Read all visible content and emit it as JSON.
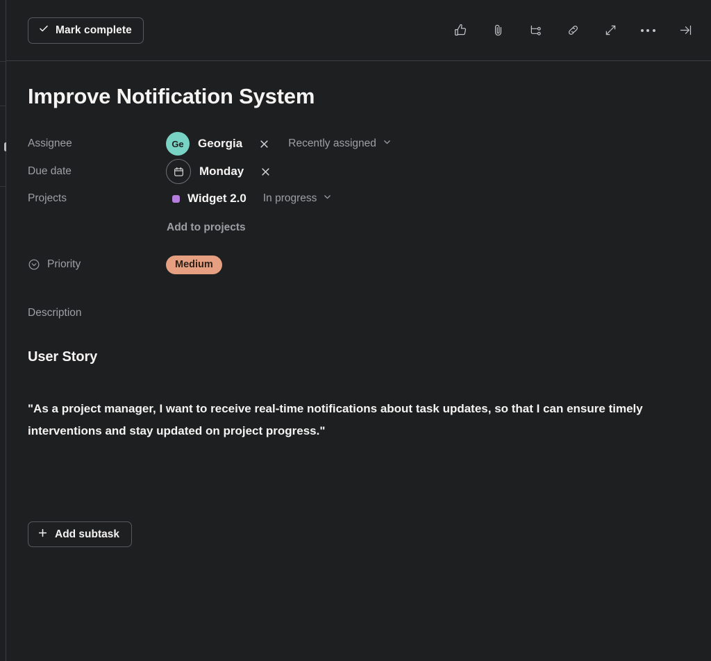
{
  "theme": {
    "background": "#1e1f21",
    "text_primary": "#f5f4f3",
    "text_secondary": "#9ca0a4",
    "border": "#565a5e",
    "avatar_color": "#79d3c4",
    "project_color": "#b57edc",
    "priority_badge_color": "#e79f81"
  },
  "header": {
    "mark_complete_label": "Mark complete",
    "check_icon": "check-icon",
    "actions": [
      {
        "name": "like-icon",
        "label": "Like"
      },
      {
        "name": "attachment-icon",
        "label": "Attach file"
      },
      {
        "name": "subtask-icon",
        "label": "Add subtask"
      },
      {
        "name": "link-icon",
        "label": "Copy task link"
      },
      {
        "name": "expand-icon",
        "label": "Full screen"
      },
      {
        "name": "more-options-icon",
        "label": "More actions"
      },
      {
        "name": "collapse-panel-icon",
        "label": "Close details"
      }
    ]
  },
  "task": {
    "title": "Improve Notification System",
    "fields": {
      "assignee": {
        "label": "Assignee",
        "avatar_initials": "Ge",
        "name": "Georgia",
        "clear_icon": "close-icon",
        "recency_label": "Recently assigned",
        "chevron_icon": "chevron-down-icon"
      },
      "due_date": {
        "label": "Due date",
        "calendar_icon": "calendar-icon",
        "value": "Monday",
        "clear_icon": "close-icon"
      },
      "projects": {
        "label": "Projects",
        "project_name": "Widget 2.0",
        "status": "In progress",
        "chevron_icon": "chevron-down-icon",
        "add_label": "Add to projects"
      },
      "priority": {
        "label": "Priority",
        "field_icon": "chevron-down-circle-icon",
        "value": "Medium"
      },
      "description": {
        "label": "Description"
      }
    },
    "description_content": {
      "heading": "User Story",
      "paragraph": "\"As a project manager, I want to receive real-time notifications about task updates, so that I can ensure timely interventions and stay updated on project progress.\""
    },
    "add_subtask_label": "Add subtask",
    "add_subtask_icon": "plus-icon"
  }
}
